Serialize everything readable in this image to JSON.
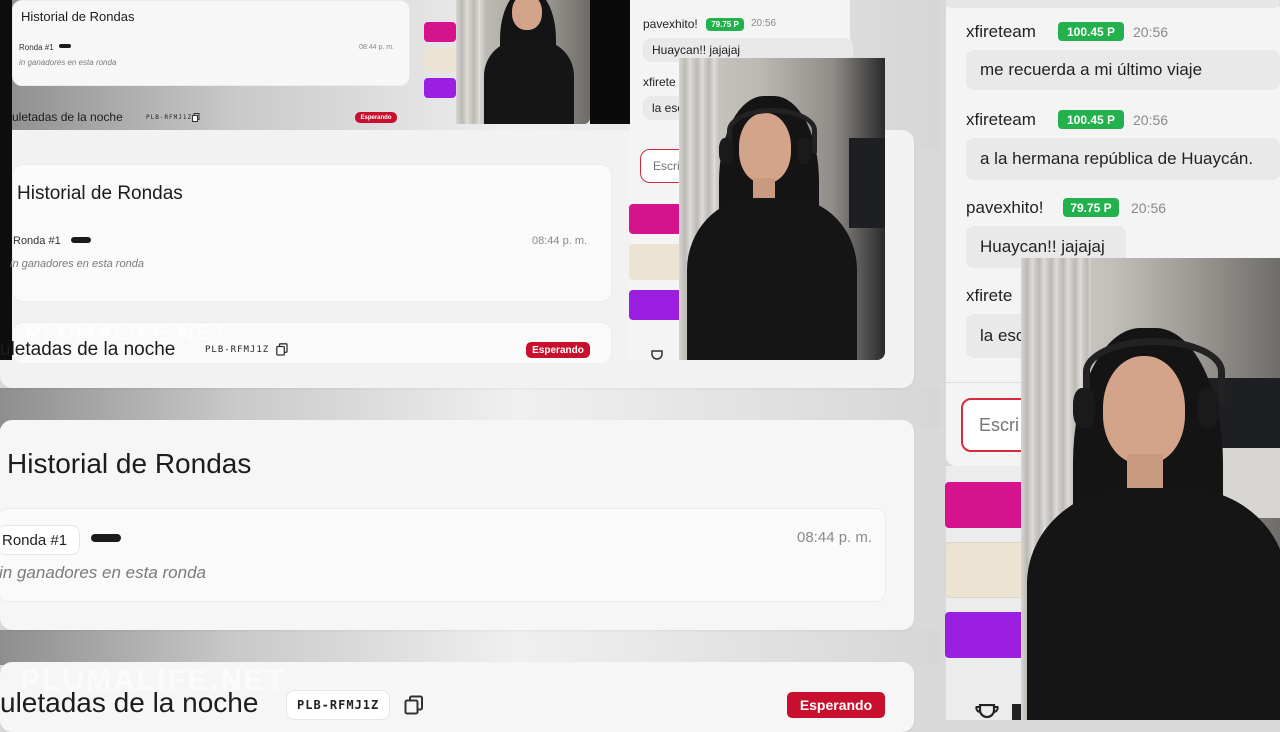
{
  "history_title": "Historial de Rondas",
  "round_label": "Ronda #1",
  "round_label_cut": "Ronda #1",
  "round_time": "08:44 p. m.",
  "no_winners": "in ganadores en esta ronda",
  "no_winners_cut": "in ganadores en esta ronda",
  "roulette_title": "uletadas de la noche",
  "room_code": "PLB-RFMJ1Z",
  "status_badge": "Esperando",
  "watermark": "PLUMALIFE.NET",
  "chat": {
    "messages": [
      {
        "user": "xfireteam",
        "points": "100.45 P",
        "time": "20:56",
        "text": "me recuerda a mi último viaje"
      },
      {
        "user": "xfireteam",
        "points": "100.45 P",
        "time": "20:56",
        "text": "a la hermana república de Huaycán."
      },
      {
        "user": "pavexhito!",
        "points": "79.75 P",
        "time": "20:56",
        "text": "Huaycan!! jajajaj"
      },
      {
        "user": "xfirete",
        "text": "la esc"
      }
    ],
    "input_placeholder": "Escri"
  },
  "mini_chat": {
    "user": "pavexhito!",
    "points": "79.75 P",
    "time": "20:56",
    "text": "Huaycan!! jajajaj",
    "user2": "xfirete",
    "text2": "la esc",
    "placeholder": "Escri"
  },
  "colors": {
    "accent_red": "#c8102e",
    "points_green": "#22b14c",
    "swatch_magenta": "#d4138c",
    "swatch_cream": "#ece3d2",
    "swatch_purple": "#9b1fe0"
  }
}
